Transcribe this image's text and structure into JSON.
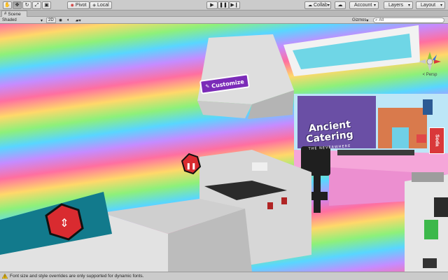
{
  "toolbar": {
    "tools": [
      {
        "name": "hand-tool",
        "icon": "hand-icon"
      },
      {
        "name": "move-tool",
        "icon": "move-arrows-icon"
      },
      {
        "name": "rotate-tool",
        "icon": "rotate-icon"
      },
      {
        "name": "scale-tool",
        "icon": "scale-icon"
      },
      {
        "name": "rect-tool",
        "icon": "rect-tool-icon"
      }
    ],
    "pivot_label": "Pivot",
    "local_label": "Local",
    "play_icon": "play-icon",
    "pause_icon": "pause-icon",
    "step_icon": "step-icon",
    "collab_label": "Collab",
    "account_label": "Account",
    "layers_label": "Layers",
    "layout_label": "Layout"
  },
  "scene_tab": {
    "label": "Scene",
    "icon": "scene-icon"
  },
  "scene_bar": {
    "shading_mode": "Shaded",
    "view_2d_label": "2D",
    "gizmos_label": "Gizmos",
    "search_placeholder": "All"
  },
  "viewport": {
    "customize_label": "Customize",
    "sign_line1": "Ancient",
    "sign_line2": "Catering",
    "sign_line3": "THE NEVERWHERE",
    "side_sign_label": "Soda",
    "gizmo_label": "< Persp"
  },
  "status": {
    "message": "Font size and style overrides are only supported for dynamic fonts.",
    "icon": "warning-icon"
  },
  "colors": {
    "toolbar_bg": "#cbcbcb",
    "customize_purple": "#7b2bb8",
    "warning_yellow": "#f2c10f",
    "hex_badge_red": "#d92b30"
  }
}
